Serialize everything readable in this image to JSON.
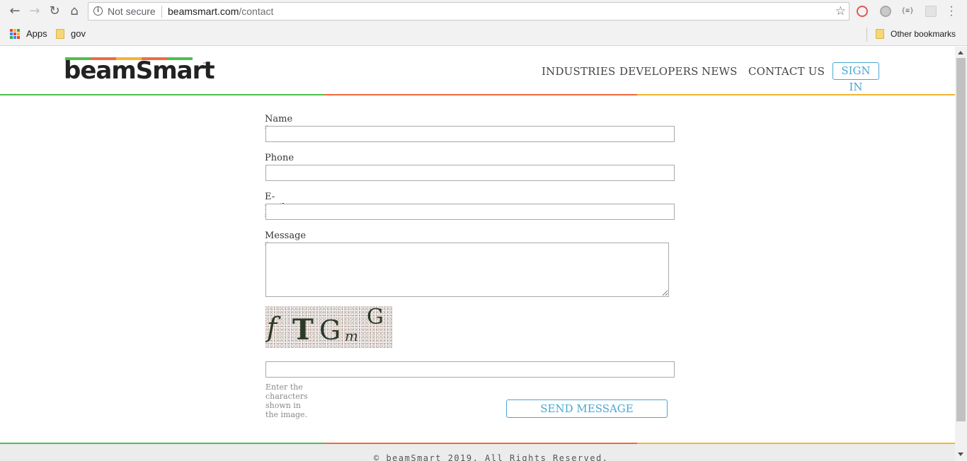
{
  "browser": {
    "security_label": "Not secure",
    "url_host": "beamsmart.com",
    "url_path": "/contact",
    "bookmarks": [
      {
        "label": "Apps"
      },
      {
        "label": "gov"
      }
    ],
    "other_bookmarks": "Other bookmarks",
    "ext3_label": "{≡}"
  },
  "site": {
    "logo": "beamSmart",
    "logo_tm": "™",
    "logo_colors": [
      "#4cc04c",
      "#f06a3c",
      "#f5b431",
      "#f06a3c",
      "#4cc04c"
    ],
    "nav": [
      "INDUSTRIES",
      "DEVELOPERS",
      "NEWS",
      "CONTACT US"
    ],
    "sign_in": "SIGN IN",
    "accent": "#4aa7d2",
    "line_colors": [
      "#4cc04c",
      "#f06a3c",
      "#f5b431"
    ]
  },
  "form": {
    "name_label": "Name",
    "phone_label": "Phone",
    "email_label": "E-mail",
    "message_label": "Message",
    "required_mark": "*",
    "captcha_chars": [
      "f",
      "T",
      "G",
      "m",
      "G"
    ],
    "captcha_hint": "Enter the characters shown in the image.",
    "send_label": "SEND MESSAGE",
    "name_value": "",
    "phone_value": "",
    "email_value": "",
    "message_value": "",
    "captcha_value": ""
  },
  "footer": {
    "text": "© beamSmart 2019. All Rights Reserved."
  }
}
